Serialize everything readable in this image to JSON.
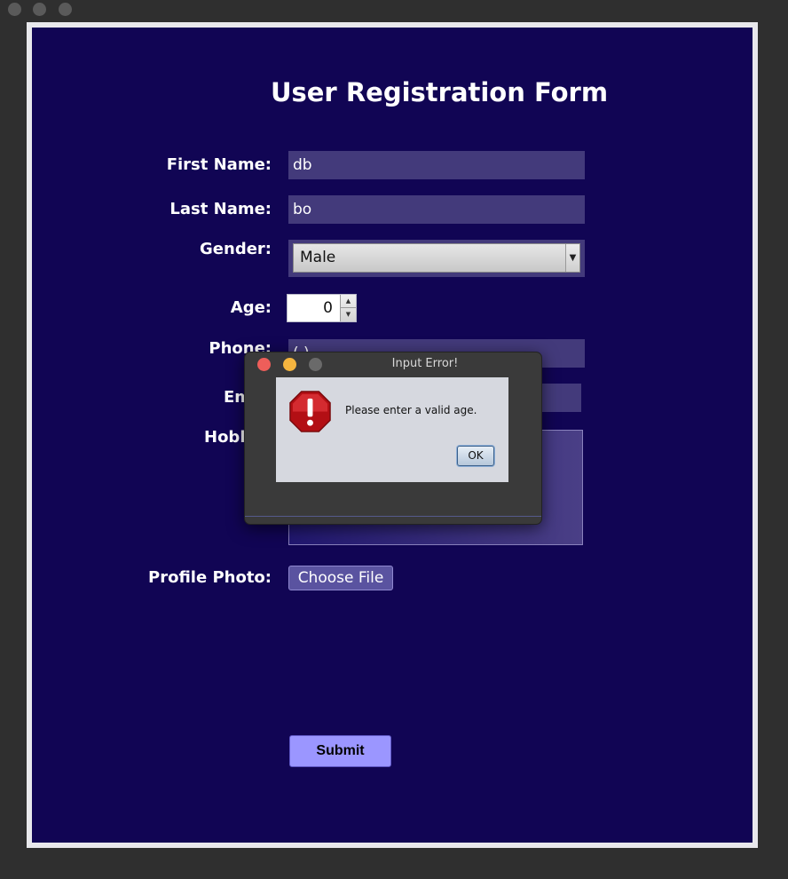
{
  "window": {
    "title": ""
  },
  "form": {
    "title": "User Registration Form",
    "first_name_label": "First Name:",
    "first_name_value": "db",
    "last_name_label": "Last Name:",
    "last_name_value": "bo",
    "gender_label": "Gender:",
    "gender_value": "Male",
    "age_label": "Age:",
    "age_value": "0",
    "phone_label": "Phone:",
    "phone_value": "(  )",
    "email_label_visible": "Em",
    "hobbies_label_visible": "Hobb",
    "profile_photo_label": "Profile Photo:",
    "choose_file_label": "Choose File",
    "submit_label": "Submit"
  },
  "dialog": {
    "title": "Input Error!",
    "message": "Please enter a valid age.",
    "ok_label": "OK",
    "icon": "error-stop-icon"
  },
  "colors": {
    "panel_bg": "#110554",
    "field_bg": "#433a7b",
    "submit_bg": "#9b96ff",
    "dialog_bg": "#3a3a3a",
    "close_dot": "#ee5e5a",
    "minimize_dot": "#f5b53f",
    "zoom_dot": "#6a6a6a"
  }
}
